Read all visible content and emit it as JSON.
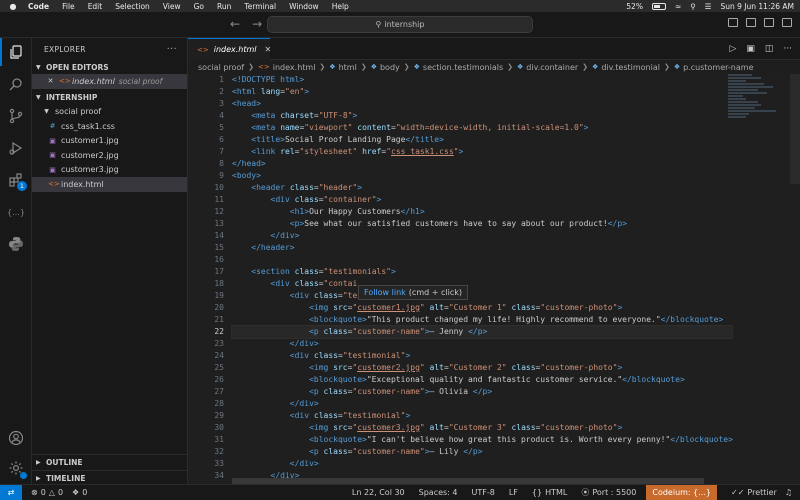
{
  "menubar": {
    "app": "Code",
    "items": [
      "File",
      "Edit",
      "Selection",
      "View",
      "Go",
      "Run",
      "Terminal",
      "Window",
      "Help"
    ],
    "battery": "52%",
    "datetime": "Sun 9 Jun  11:26 AM"
  },
  "titlebar": {
    "search_text": "internship"
  },
  "activity": {
    "extensions_badge": "1",
    "json_label": "{...}"
  },
  "sidebar": {
    "title": "EXPLORER",
    "open_editors": {
      "title": "OPEN EDITORS",
      "items": [
        {
          "name": "index.html",
          "desc": "social proof"
        }
      ]
    },
    "workspace": {
      "title": "INTERNSHIP",
      "folder": "social proof",
      "files": [
        "css_task1.css",
        "customer1.jpg",
        "customer2.jpg",
        "customer3.jpg",
        "index.html"
      ]
    },
    "outline": "OUTLINE",
    "timeline": "TIMELINE"
  },
  "editor": {
    "tab_label": "index.html",
    "breadcrumb": [
      "social proof",
      "index.html",
      "html",
      "body",
      "section.testimonials",
      "div.container",
      "div.testimonial",
      "p.customer-name"
    ],
    "current_line": 22
  },
  "code": {
    "l1": "<!DOCTYPE html>",
    "l2_tag": "<html",
    "l2_attr": "lang",
    "l2_val": "\"en\"",
    "l3": "<head>",
    "l4_tag": "<meta",
    "l4_attr": "charset",
    "l4_val": "\"UTF-8\"",
    "l5_tag": "<meta",
    "l5_a1": "name",
    "l5_v1": "\"viewport\"",
    "l5_a2": "content",
    "l5_v2": "\"width=device-width, initial-scale=1.0\"",
    "l6_text": "Social Proof Landing Page",
    "l7_tag": "<link",
    "l7_a1": "rel",
    "l7_v1": "\"stylesheet\"",
    "l7_a2": "href",
    "l7_v2": "css_task1.css",
    "l8": "</head>",
    "l9": "<body>",
    "l10_tag": "<header",
    "l10_attr": "class",
    "l10_val": "\"header\"",
    "l11_tag": "<div",
    "l11_attr": "class",
    "l11_val": "\"container\"",
    "l12_text": "Our Happy Customers",
    "l13_text": "See what our satisfied customers have to say about our product!",
    "l14": "</div>",
    "l15": "</header>",
    "l17_tag": "<section",
    "l17_attr": "class",
    "l17_val": "\"testimonials\"",
    "l18_tag": "<div",
    "l18_attr": "class",
    "l18_val": "\"contai",
    "l19_tag": "<div",
    "l19_attr": "class",
    "l19_val": "\"te",
    "l20_img": "customer1.jpg",
    "l20_alt": "\"Customer 1\"",
    "l20_cls": "\"customer-photo\"",
    "l21_text": "\"This product changed my life! Highly recommend to everyone.\"",
    "l22_cls": "\"customer-name\"",
    "l22_text": "— Jenny ",
    "l24_val": "\"testimonial\"",
    "l25_img": "customer2.jpg",
    "l25_alt": "\"Customer 2\"",
    "l25_cls": "\"customer-photo\"",
    "l26_text": "\"Exceptional quality and fantastic customer service.\"",
    "l27_cls": "\"customer-name\"",
    "l27_text": "— Olivia ",
    "l29_val": "\"testimonial\"",
    "l30_img": "customer3.jpg",
    "l30_alt": "\"Customer 3\"",
    "l30_cls": "\"customer-photo\"",
    "l31_text": "\"I can't believe how great this product is. Worth every penny!\"",
    "l32_cls": "\"customer-name\"",
    "l32_text": "— Lily ",
    "tag_meta": "<meta",
    "tag_img": "<img",
    "tag_p": "<p",
    "tag_div": "<div",
    "attr_src": "src",
    "attr_alt": "alt",
    "attr_class": "class",
    "attr_name": "name"
  },
  "tooltip": {
    "link": "Follow link",
    "hint": "(cmd + click)"
  },
  "statusbar": {
    "errors": "0",
    "warnings": "0",
    "ports": "0",
    "position": "Ln 22, Col 30",
    "spaces": "Spaces: 4",
    "encoding": "UTF-8",
    "eol": "LF",
    "language": "HTML",
    "port": "Port : 5500",
    "codeium": "Codeium: {...}",
    "prettier": "Prettier"
  },
  "colors": {
    "accent": "#0078d4",
    "editor_bg": "#1f1f1f",
    "tag": "#569cd6",
    "attribute": "#9cdcfe",
    "string": "#ce9178",
    "codeium_bg": "#c76a2b"
  }
}
